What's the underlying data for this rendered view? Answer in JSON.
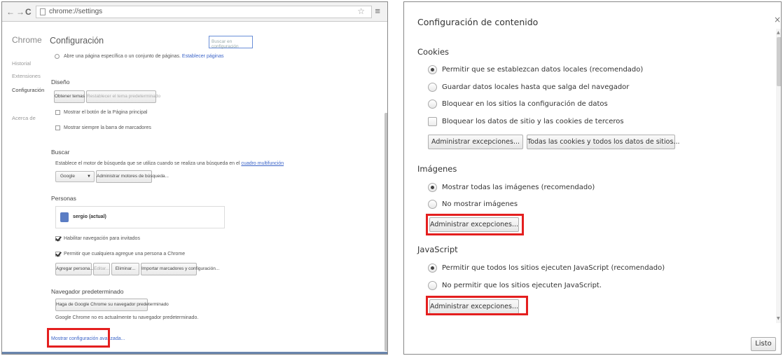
{
  "browser": {
    "url": "chrome://settings",
    "back_icon": "←",
    "forward_icon": "→",
    "reload_icon": "C",
    "star_icon": "☆",
    "menu_icon": "≡"
  },
  "sidebar": {
    "brand": "Chrome",
    "items": [
      {
        "label": "Historial"
      },
      {
        "label": "Extensiones"
      },
      {
        "label": "Configuración"
      },
      {
        "label": "Acerca de"
      }
    ]
  },
  "settings": {
    "title": "Configuración",
    "search_placeholder": "Buscar en configuración",
    "startup_option": "Abre una página específica o un conjunto de páginas.",
    "startup_link": "Establecer páginas",
    "appearance": {
      "heading": "Diseño",
      "get_themes": "Obtener temas",
      "reset_theme": "Restablecer el tema predeterminado",
      "show_home": "Mostrar el botón de la Página principal",
      "show_bookmarks": "Mostrar siempre la barra de marcadores"
    },
    "search": {
      "heading": "Buscar",
      "description": "Establece el motor de búsqueda que se utiliza cuando se realiza una búsqueda en el",
      "description_link": "cuadro multifunción",
      "engine": "Google",
      "manage_engines": "Administrar motores de búsqueda..."
    },
    "people": {
      "heading": "Personas",
      "profile": "sergio (actual)",
      "guest": "Habilitar navegación para invitados",
      "anyone_add": "Permitir que cualquiera agregue una persona a Chrome",
      "add_person": "Agregar persona...",
      "edit": "Editar...",
      "remove": "Eliminar...",
      "import": "Importar marcadores y configuración..."
    },
    "default_browser": {
      "heading": "Navegador predeterminado",
      "make_default": "Haga de Google Chrome su navegador predeterminado",
      "status": "Google Chrome no es actualmente tu navegador predeterminado."
    },
    "advanced_link": "Mostrar configuración avanzada..."
  },
  "dialog": {
    "title": "Configuración de contenido",
    "close_icon": "×",
    "cookies": {
      "heading": "Cookies",
      "options": [
        "Permitir que se establezcan datos locales (recomendado)",
        "Guardar datos locales hasta que salga del navegador",
        "Bloquear en los sitios la configuración de datos"
      ],
      "selected_index": 0,
      "block_third_party": "Bloquear los datos de sitio y las cookies de terceros",
      "manage_exceptions": "Administrar excepciones...",
      "all_cookies": "Todas las cookies y todos los datos de sitios..."
    },
    "images": {
      "heading": "Imágenes",
      "options": [
        "Mostrar todas las imágenes (recomendado)",
        "No mostrar imágenes"
      ],
      "selected_index": 0,
      "manage_exceptions": "Administrar excepciones..."
    },
    "javascript": {
      "heading": "JavaScript",
      "options": [
        "Permitir que todos los sitios ejecuten JavaScript (recomendado)",
        "No permitir que los sitios ejecuten JavaScript."
      ],
      "selected_index": 0,
      "manage_exceptions": "Administrar excepciones..."
    },
    "done": "Listo"
  },
  "colors": {
    "highlight": "#e41f1f",
    "link": "#3b64c8"
  }
}
